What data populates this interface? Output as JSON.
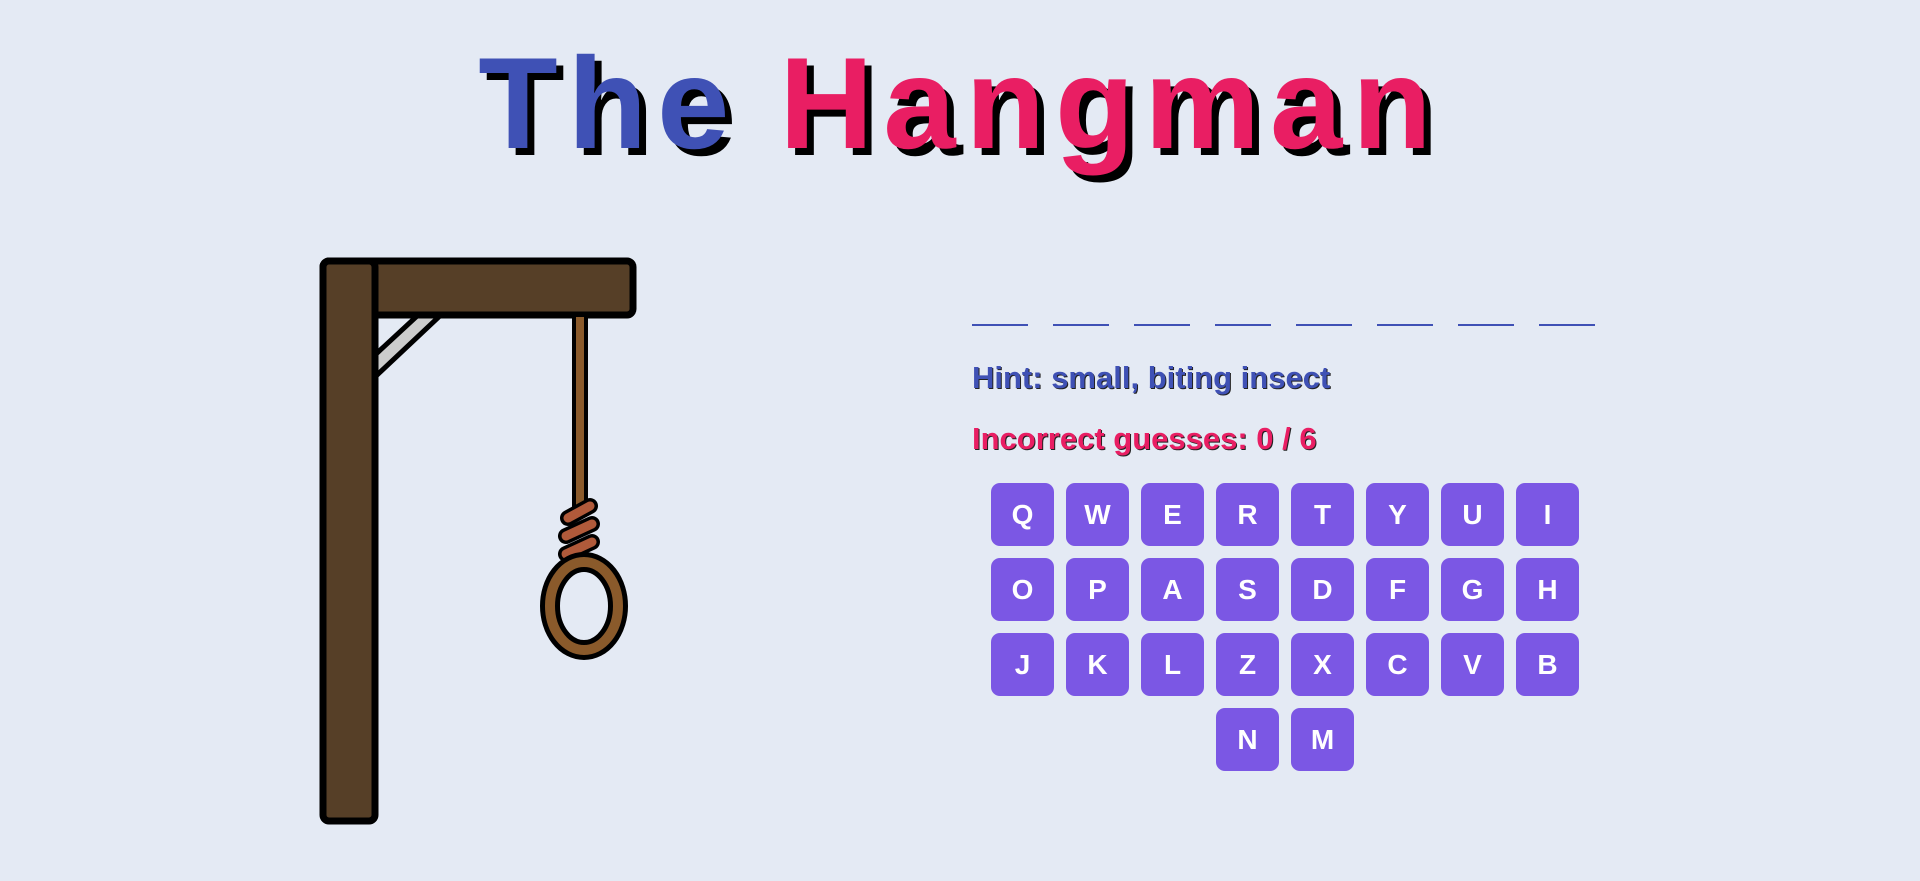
{
  "title": {
    "word1": "The",
    "word2": "Hangman"
  },
  "colors": {
    "title_blue": "#3f51b5",
    "title_pink": "#e91e63",
    "key_bg": "#7b57e4",
    "background": "#e4eaf4",
    "gallows_wood": "#563f27",
    "rope": "#8a5a2b"
  },
  "word": {
    "letters": [
      "",
      "",
      "",
      "",
      "",
      "",
      "",
      ""
    ]
  },
  "hint": {
    "text": "Hint: small, biting insect"
  },
  "guesses": {
    "text": "Incorrect guesses: 0 / 6",
    "incorrect": 0,
    "max": 6
  },
  "keyboard": {
    "keys": [
      "Q",
      "W",
      "E",
      "R",
      "T",
      "Y",
      "U",
      "I",
      "O",
      "P",
      "A",
      "S",
      "D",
      "F",
      "G",
      "H",
      "J",
      "K",
      "L",
      "Z",
      "X",
      "C",
      "V",
      "B",
      "N",
      "M"
    ]
  }
}
